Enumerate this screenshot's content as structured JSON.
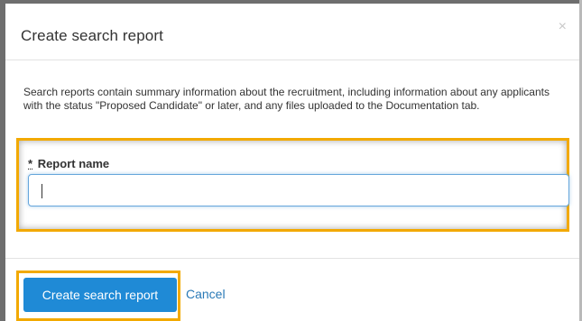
{
  "dialog": {
    "title": "Create search report",
    "close_icon": "×",
    "description": "Search reports contain summary information about the recruitment, including information about any applicants with the status \"Proposed Candidate\" or later, and any files uploaded to the Documentation tab.",
    "field": {
      "required_mark": "*",
      "label": "Report name",
      "value": "",
      "placeholder": ""
    },
    "buttons": {
      "create_label": "Create search report",
      "cancel_label": "Cancel"
    },
    "colors": {
      "primary": "#1f8ad6",
      "link": "#2a7ab7",
      "highlight": "#f2a900"
    },
    "icons": [
      "close-icon"
    ]
  }
}
